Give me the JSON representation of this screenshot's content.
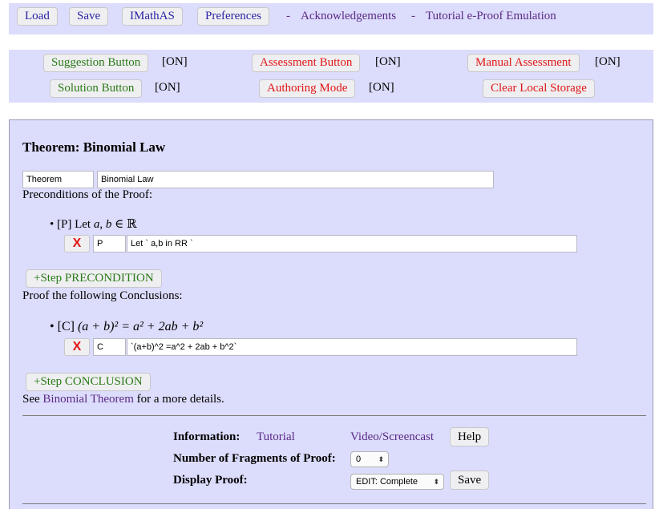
{
  "toolbar": {
    "load": "Load",
    "save": "Save",
    "imathas": "IMathAS",
    "preferences": "Preferences",
    "sep1": "-",
    "acknowledgements": "Acknowledgements",
    "sep2": "-",
    "tutorial_link": "Tutorial e-Proof Emulation"
  },
  "modes": {
    "suggestion": {
      "label": "Suggestion Button",
      "state": "[ON]"
    },
    "assessment": {
      "label": "Assessment Button",
      "state": "[ON]"
    },
    "manual": {
      "label": "Manual Assessment",
      "state": "[ON]"
    },
    "solution": {
      "label": "Solution Button",
      "state": "[ON]"
    },
    "authoring": {
      "label": "Authoring Mode",
      "state": "[ON]"
    },
    "clear": {
      "label": "Clear Local Storage"
    }
  },
  "theorem": {
    "heading": "Theorem: Binomial Law",
    "type_value": "Theorem",
    "name_value": "Binomial Law",
    "preconditions_label": "Preconditions of the Proof:",
    "precondition": {
      "tag": "[P] Let ",
      "math_a": "a",
      "comma": ", ",
      "math_b": "b",
      "in": " ∈ ",
      "reals": "ℝ",
      "delete": "X",
      "id_value": "P",
      "expr_value": "Let ` a,b in RR `"
    },
    "add_precondition": "+Step PRECONDITION",
    "conclusions_label": "Proof the following Conclusions:",
    "conclusion": {
      "tag": "[C] ",
      "formula": "(a + b)² = a² + 2ab + b²",
      "delete": "X",
      "id_value": "C",
      "expr_value": "`(a+b)^2 =a^2 + 2ab + b^2`"
    },
    "add_conclusion": "+Step CONCLUSION",
    "see_prefix": "See ",
    "see_link": "Binomial Theorem",
    "see_suffix": " for a more details."
  },
  "info": {
    "information_label": "Information:",
    "tutorial": "Tutorial",
    "video": "Video/Screencast",
    "help": "Help",
    "fragments_label": "Number of Fragments of Proof:",
    "fragments_value": "0",
    "display_label": "Display Proof:",
    "display_value": "EDIT: Complete",
    "save": "Save"
  },
  "colors": {
    "panel": "#dcdcfc",
    "link_purple": "#5a2a86",
    "button_green": "#2a7a18",
    "button_red": "#e01616",
    "button_navy": "#2a23a6"
  }
}
